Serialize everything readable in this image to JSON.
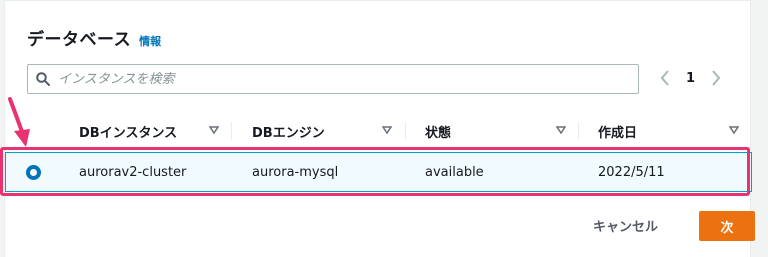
{
  "panel": {
    "title": "データベース",
    "info_link": "情報"
  },
  "search": {
    "placeholder": "インスタンスを検索",
    "value": ""
  },
  "pagination": {
    "prev_icon": "chevron-left-icon",
    "current_page": "1",
    "next_icon": "chevron-right-icon"
  },
  "table": {
    "columns": [
      "DBインスタンス",
      "DBエンジン",
      "状態",
      "作成日"
    ],
    "rows": [
      {
        "selected": true,
        "cells": [
          "aurorav2-cluster",
          "aurora-mysql",
          "available",
          "2022/5/11"
        ]
      }
    ]
  },
  "footer": {
    "cancel_label": "キャンセル",
    "next_label": "次"
  },
  "colors": {
    "accent": "#0073bb",
    "primary_button": "#ec7211",
    "selection_border": "#00a1c9",
    "annotation": "#e8336f"
  }
}
